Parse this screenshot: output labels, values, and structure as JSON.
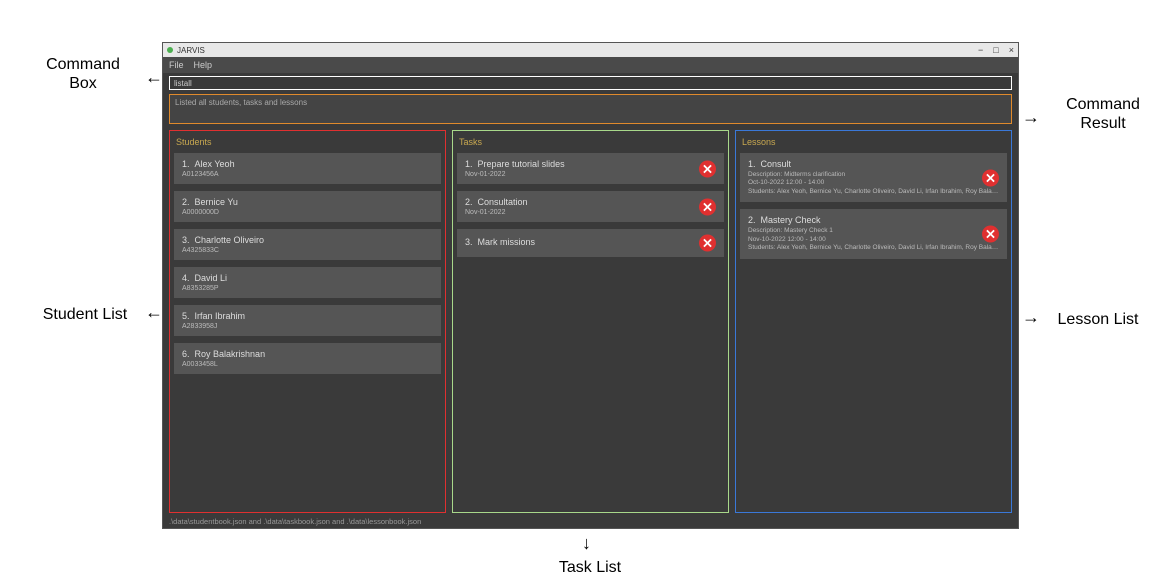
{
  "annotations": {
    "command_box": "Command\nBox",
    "command_result": "Command\nResult",
    "student_list": "Student List",
    "task_list": "Task List",
    "lesson_list": "Lesson List"
  },
  "titlebar": {
    "title": "JARVIS",
    "min": "−",
    "max": "□",
    "close": "×"
  },
  "menu": {
    "file": "File",
    "help": "Help"
  },
  "command_box": {
    "value": "listall"
  },
  "command_result": "Listed all students, tasks and lessons",
  "panels": {
    "students_header": "Students",
    "tasks_header": "Tasks",
    "lessons_header": "Lessons"
  },
  "students": [
    {
      "idx": "1.",
      "name": "Alex Yeoh",
      "id": "A0123456A"
    },
    {
      "idx": "2.",
      "name": "Bernice Yu",
      "id": "A0000000D"
    },
    {
      "idx": "3.",
      "name": "Charlotte Oliveiro",
      "id": "A4325833C"
    },
    {
      "idx": "4.",
      "name": "David Li",
      "id": "A8353285P"
    },
    {
      "idx": "5.",
      "name": "Irfan Ibrahim",
      "id": "A2833958J"
    },
    {
      "idx": "6.",
      "name": "Roy Balakrishnan",
      "id": "A0033458L"
    }
  ],
  "tasks": [
    {
      "idx": "1.",
      "name": "Prepare tutorial slides",
      "date": "Nov-01-2022"
    },
    {
      "idx": "2.",
      "name": "Consultation",
      "date": "Nov-01-2022"
    },
    {
      "idx": "3.",
      "name": "Mark missions",
      "date": ""
    }
  ],
  "lessons": [
    {
      "idx": "1.",
      "name": "Consult",
      "desc": "Description: Midterms clarification",
      "date": "Oct-10-2022 12:00 - 14:00",
      "students": "Students: Alex Yeoh, Bernice Yu, Charlotte Oliveiro, David Li, Irfan Ibrahim, Roy Balakrishn..."
    },
    {
      "idx": "2.",
      "name": "Mastery Check",
      "desc": "Description: Mastery Check 1",
      "date": "Nov-10-2022 12:00 - 14:00",
      "students": "Students: Alex Yeoh, Bernice Yu, Charlotte Oliveiro, David Li, Irfan Ibrahim, Roy Balakrishn..."
    }
  ],
  "statusbar": ".\\data\\studentbook.json and .\\data\\taskbook.json and .\\data\\lessonbook.json"
}
